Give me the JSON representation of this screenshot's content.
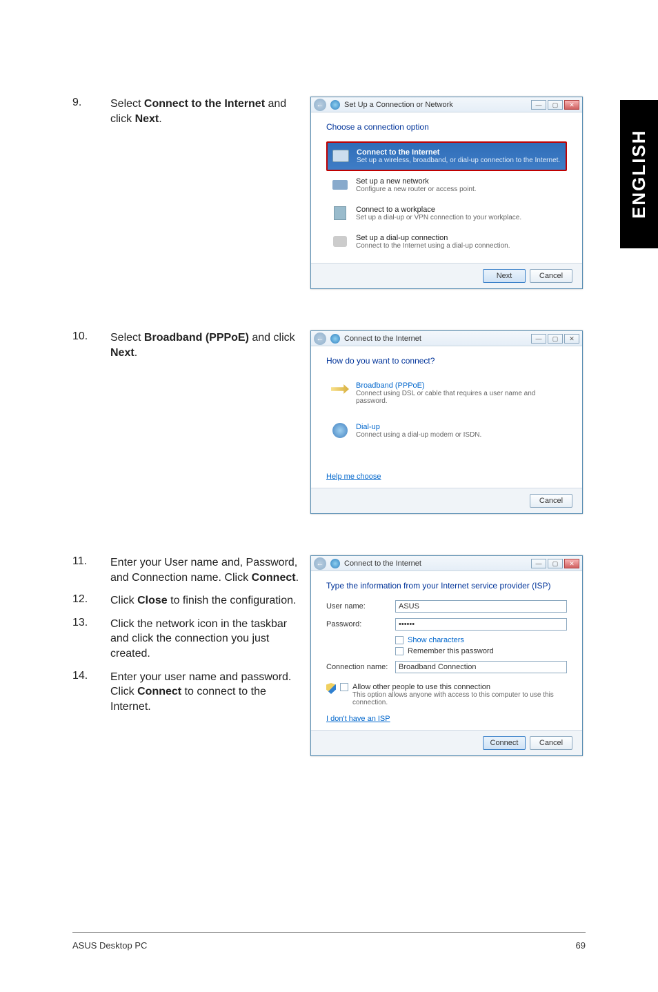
{
  "side_tab": "ENGLISH",
  "steps": {
    "s9": {
      "num": "9.",
      "text_before": "Select ",
      "bold1": "Connect to the Internet",
      "text_mid": " and click ",
      "bold2": "Next",
      "text_after": "."
    },
    "s10": {
      "num": "10.",
      "text_before": "Select ",
      "bold1": "Broadband (PPPoE)",
      "text_mid": " and click ",
      "bold2": "Next",
      "text_after": "."
    },
    "s11": {
      "num": "11.",
      "text": "Enter your User name and, Password, and Connection name. Click ",
      "bold": "Connect",
      "after": "."
    },
    "s12": {
      "num": "12.",
      "text": "Click ",
      "bold": "Close",
      "after": " to finish the configuration."
    },
    "s13": {
      "num": "13.",
      "text": "Click the network icon in the taskbar and click the connection you just created."
    },
    "s14": {
      "num": "14.",
      "text": "Enter your user name and password. Click ",
      "bold": "Connect",
      "after": " to connect to the Internet."
    }
  },
  "dialog1": {
    "title": "Set Up a Connection or Network",
    "heading": "Choose a connection option",
    "opts": [
      {
        "title": "Connect to the Internet",
        "desc": "Set up a wireless, broadband, or dial-up connection to the Internet."
      },
      {
        "title": "Set up a new network",
        "desc": "Configure a new router or access point."
      },
      {
        "title": "Connect to a workplace",
        "desc": "Set up a dial-up or VPN connection to your workplace."
      },
      {
        "title": "Set up a dial-up connection",
        "desc": "Connect to the Internet using a dial-up connection."
      }
    ],
    "btn_next": "Next",
    "btn_cancel": "Cancel"
  },
  "dialog2": {
    "title": "Connect to the Internet",
    "heading": "How do you want to connect?",
    "opts": [
      {
        "title": "Broadband (PPPoE)",
        "desc": "Connect using DSL or cable that requires a user name and password."
      },
      {
        "title": "Dial-up",
        "desc": "Connect using a dial-up modem or ISDN."
      }
    ],
    "help": "Help me choose",
    "btn_cancel": "Cancel"
  },
  "dialog3": {
    "title": "Connect to the Internet",
    "heading": "Type the information from your Internet service provider (ISP)",
    "user_label": "User name:",
    "user_value": "ASUS",
    "pass_label": "Password:",
    "pass_value": "••••••",
    "show_chars": "Show characters",
    "remember": "Remember this password",
    "conn_label": "Connection name:",
    "conn_value": "Broadband Connection",
    "allow_label": "Allow other people to use this connection",
    "allow_desc": "This option allows anyone with access to this computer to use this connection.",
    "no_isp": "I don't have an ISP",
    "btn_connect": "Connect",
    "btn_cancel": "Cancel"
  },
  "footer": {
    "left": "ASUS Desktop PC",
    "right": "69"
  }
}
